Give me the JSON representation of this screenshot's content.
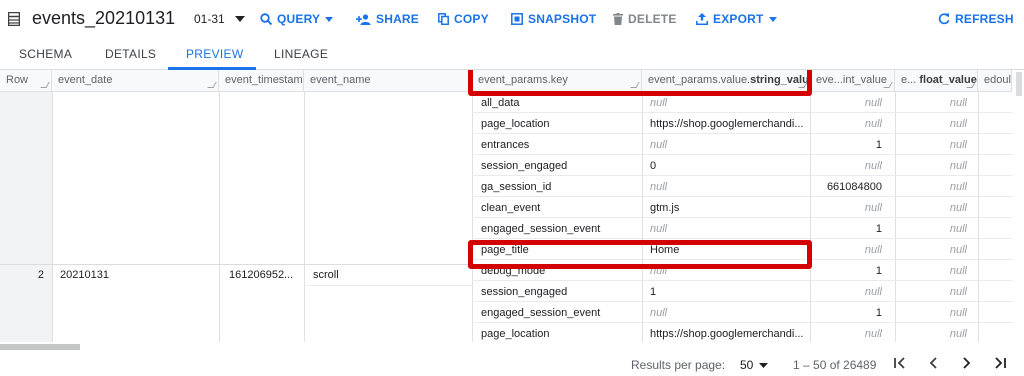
{
  "toolbar": {
    "title": "events_20210131",
    "version": "01-31",
    "query": "QUERY",
    "share": "SHARE",
    "copy": "COPY",
    "snapshot": "SNAPSHOT",
    "delete": "DELETE",
    "export": "EXPORT",
    "refresh": "REFRESH"
  },
  "tabs": [
    "SCHEMA",
    "DETAILS",
    "PREVIEW",
    "LINEAGE"
  ],
  "active_tab": "PREVIEW",
  "columns": {
    "row": "Row",
    "event_date": "event_date",
    "event_timestamp": "event_timestamp",
    "event_name": "event_name",
    "key": "event_params.key",
    "string_value_prefix": "event_params.value.",
    "string_value_bold": "string_value",
    "int_value": "eve...int_value",
    "float_value_prefix": "e...",
    "float_value_bold": "float_value",
    "double_value": "edoul"
  },
  "row2": {
    "row": "2",
    "event_date": "20210131",
    "event_timestamp": "161206952...",
    "event_name": "scroll"
  },
  "params": [
    {
      "key": "all_data",
      "string": "null",
      "int": "null"
    },
    {
      "key": "page_location",
      "string": "https://shop.googlemerchandi...",
      "int": "null"
    },
    {
      "key": "entrances",
      "string": "null",
      "int": "1"
    },
    {
      "key": "session_engaged",
      "string": "0",
      "int": "null"
    },
    {
      "key": "ga_session_id",
      "string": "null",
      "int": "661084800"
    },
    {
      "key": "clean_event",
      "string": "gtm.js",
      "int": "null"
    },
    {
      "key": "engaged_session_event",
      "string": "null",
      "int": "1"
    },
    {
      "key": "page_title",
      "string": "Home",
      "int": "null"
    },
    {
      "key": "debug_mode",
      "string": "null",
      "int": "1"
    },
    {
      "key": "session_engaged",
      "string": "1",
      "int": "null"
    },
    {
      "key": "engaged_session_event",
      "string": "null",
      "int": "1"
    },
    {
      "key": "page_location",
      "string": "https://shop.googlemerchandi...",
      "int": "null"
    }
  ],
  "null_text": "null",
  "footer": {
    "results_label": "Results per page:",
    "page_size": "50",
    "range": "1 – 50 of 26489"
  },
  "colors": {
    "accent": "#1a73e8",
    "highlight": "#d40000"
  }
}
